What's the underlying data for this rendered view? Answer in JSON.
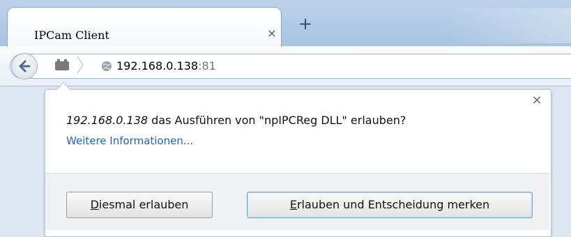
{
  "tabs": [
    {
      "title": "IPCam Client",
      "close_glyph": "×"
    }
  ],
  "new_tab_glyph": "+",
  "nav": {
    "back_icon": "back-arrow-icon",
    "plugin_icon": "plugin-icon",
    "site_icon": "globe-icon",
    "url_host": "192.168.0.138",
    "url_port": ":81"
  },
  "doorhanger": {
    "close_glyph": "×",
    "host": "192.168.0.138",
    "message": " das Ausführen von \"npIPCReg DLL\" erlauben?",
    "more_info": "Weitere Informationen...",
    "buttons": {
      "allow_once_accel": "D",
      "allow_once_rest": "iesmal erlauben",
      "allow_remember_accel": "E",
      "allow_remember_rest": "rlauben und Entscheidung merken"
    }
  },
  "colors": {
    "link": "#1c64c9",
    "tabstrip": "#bdd3ea"
  }
}
